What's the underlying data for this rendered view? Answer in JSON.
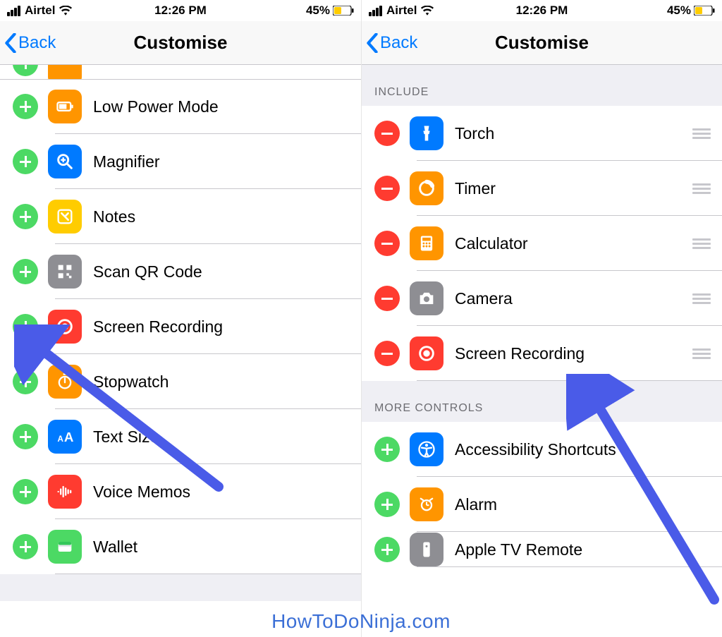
{
  "status": {
    "carrier": "Airtel",
    "time": "12:26 PM",
    "battery_pct": "45%"
  },
  "nav": {
    "back": "Back",
    "title": "Customise"
  },
  "left": {
    "items": [
      {
        "label": "Low Power Mode"
      },
      {
        "label": "Magnifier"
      },
      {
        "label": "Notes"
      },
      {
        "label": "Scan QR Code"
      },
      {
        "label": "Screen Recording"
      },
      {
        "label": "Stopwatch"
      },
      {
        "label": "Text Size"
      },
      {
        "label": "Voice Memos"
      },
      {
        "label": "Wallet"
      }
    ]
  },
  "right": {
    "section_include": "INCLUDE",
    "section_more": "MORE CONTROLS",
    "include": [
      {
        "label": "Torch"
      },
      {
        "label": "Timer"
      },
      {
        "label": "Calculator"
      },
      {
        "label": "Camera"
      },
      {
        "label": "Screen Recording"
      }
    ],
    "more": [
      {
        "label": "Accessibility Shortcuts"
      },
      {
        "label": "Alarm"
      },
      {
        "label": "Apple TV Remote"
      }
    ]
  },
  "watermark": "HowToDoNinja.com"
}
